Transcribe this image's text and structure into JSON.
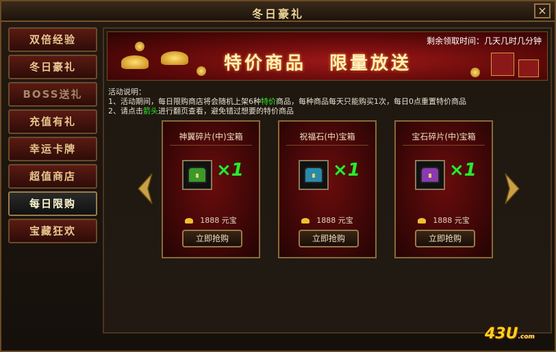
{
  "window": {
    "title": "冬日豪礼",
    "close_label": "×"
  },
  "sidebar": {
    "items": [
      {
        "label": "双倍经验",
        "state": "normal"
      },
      {
        "label": "冬日豪礼",
        "state": "normal"
      },
      {
        "label": "BOSS送礼",
        "state": "dim"
      },
      {
        "label": "充值有礼",
        "state": "normal"
      },
      {
        "label": "幸运卡牌",
        "state": "normal"
      },
      {
        "label": "超值商店",
        "state": "normal"
      },
      {
        "label": "每日限购",
        "state": "active"
      },
      {
        "label": "宝藏狂欢",
        "state": "normal"
      }
    ]
  },
  "banner": {
    "remaining_time": "剩余领取时间：几天几时几分钟",
    "title_left": "特价商品",
    "title_right": "限量放送"
  },
  "description": {
    "heading": "活动说明：",
    "line1_a": "1、活动期间，每日限购商店将会随机上架",
    "line1_num": "6",
    "line1_b": "种",
    "line1_hl": "特价",
    "line1_c": "商品，每种商品每天只能购买",
    "line1_times": "1次",
    "line1_d": "，每日",
    "line1_hour": "0点",
    "line1_e": "重置特价商品",
    "line2_a": "2、请点击",
    "line2_hl": "箭头",
    "line2_b": "进行翻页查看，避免错过想要的特价商品"
  },
  "products": [
    {
      "name": "神翼碎片(中)宝箱",
      "icon": "green-chest-icon",
      "color": "#3a9a2a",
      "quantity": "×1",
      "price": "1888",
      "currency": "元宝",
      "buy_label": "立即抢购"
    },
    {
      "name": "祝福石(中)宝箱",
      "icon": "blue-chest-icon",
      "color": "#2a8aaa",
      "quantity": "×1",
      "price": "1888",
      "currency": "元宝",
      "buy_label": "立即抢购"
    },
    {
      "name": "宝石碎片(中)宝箱",
      "icon": "purple-chest-icon",
      "color": "#8a3ab0",
      "quantity": "×1",
      "price": "1888",
      "currency": "元宝",
      "buy_label": "立即抢购"
    }
  ],
  "brand": {
    "logo": "43U",
    "suffix": ".com"
  },
  "colors": {
    "highlight_green": "#2ee82e",
    "gold": "#f0d79a",
    "banner_red": "#a01818"
  }
}
